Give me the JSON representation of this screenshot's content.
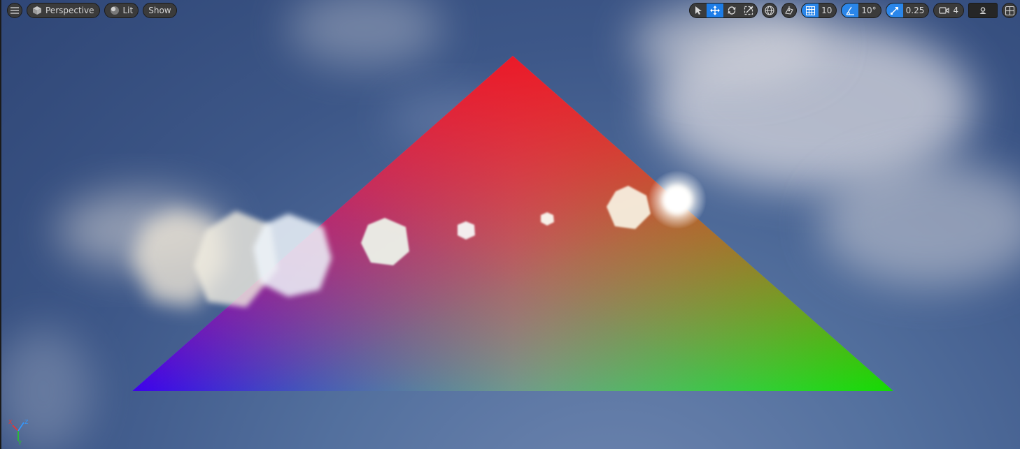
{
  "viewport": {
    "view_mode_label": "Perspective",
    "lighting_label": "Lit",
    "show_label": "Show"
  },
  "toolbar_right": {
    "grid_snap_value": "10",
    "rotation_snap_value": "10°",
    "scale_snap_value": "0.25",
    "camera_speed_value": "4"
  },
  "axis_gizmo": {
    "x_label": "X",
    "y_label": "Y",
    "z_label": "Z"
  },
  "colors": {
    "accent": "#1d7de8",
    "triangle_top": "#e8141e",
    "triangle_left": "#2200e8",
    "triangle_right": "#00e000",
    "triangle_bottom_mid": "#00b6d2"
  }
}
